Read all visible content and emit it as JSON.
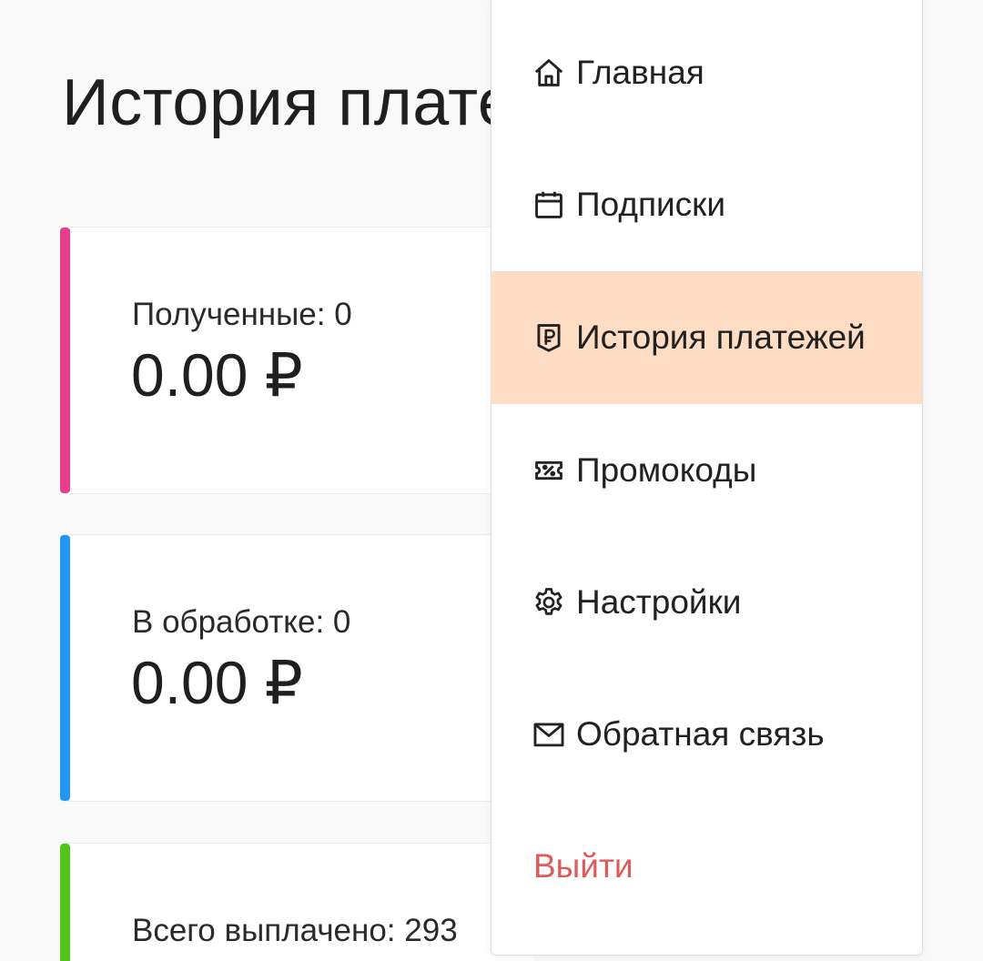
{
  "page": {
    "title": "История платежей"
  },
  "cards": [
    {
      "label": "Полученные: 0",
      "amount": "0.00 ₽",
      "accent_color": "#e83e8c"
    },
    {
      "label": "В обработке: 0",
      "amount": "0.00 ₽",
      "accent_color": "#2196f3"
    },
    {
      "label": "Всего выплачено: 293",
      "accent_color": "#52c41a"
    }
  ],
  "menu": {
    "active_color": "#ffdcc4",
    "logout_color": "#e05a5a",
    "items": [
      {
        "label": "Главная",
        "icon": "home-icon"
      },
      {
        "label": "Подписки",
        "icon": "calendar-icon"
      },
      {
        "label": "История платежей",
        "icon": "ruble-receipt-icon",
        "active": true
      },
      {
        "label": "Промокоды",
        "icon": "coupon-icon"
      },
      {
        "label": "Настройки",
        "icon": "gear-icon"
      },
      {
        "label": "Обратная связь",
        "icon": "envelope-icon"
      }
    ],
    "logout_label": "Выйти"
  }
}
